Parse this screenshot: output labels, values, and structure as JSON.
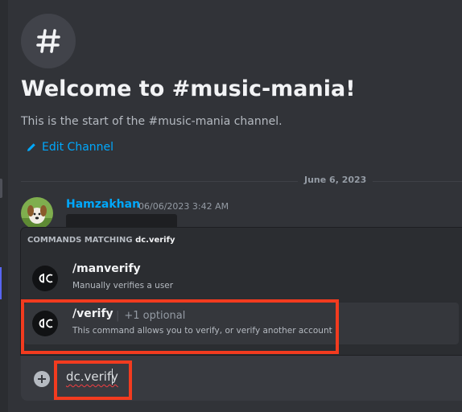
{
  "welcome": {
    "title": "Welcome to #music-mania!",
    "subtitle": "This is the start of the #music-mania channel.",
    "edit_label": "Edit Channel"
  },
  "divider": {
    "date": "June 6, 2023"
  },
  "message": {
    "author": "Hamzakhan",
    "timestamp": "06/06/2023 3:42 AM"
  },
  "autocomplete": {
    "header_prefix": "COMMANDS MATCHING",
    "query": "dc.verify",
    "commands": [
      {
        "name": "/manverify",
        "optional": "",
        "description": "Manually verifies a user",
        "selected": false
      },
      {
        "name": "/verify",
        "optional": "+1 optional",
        "description": "This command allows you to verify, or verify another account",
        "selected": true
      }
    ]
  },
  "composer": {
    "value": "dc.verify"
  },
  "colors": {
    "accent_link": "#00a8fc",
    "highlight_box": "#f23b1f",
    "background": "#313338"
  },
  "icons": [
    "hash-icon",
    "pencil-icon",
    "dc-bot-icon",
    "plus-circle-icon"
  ]
}
